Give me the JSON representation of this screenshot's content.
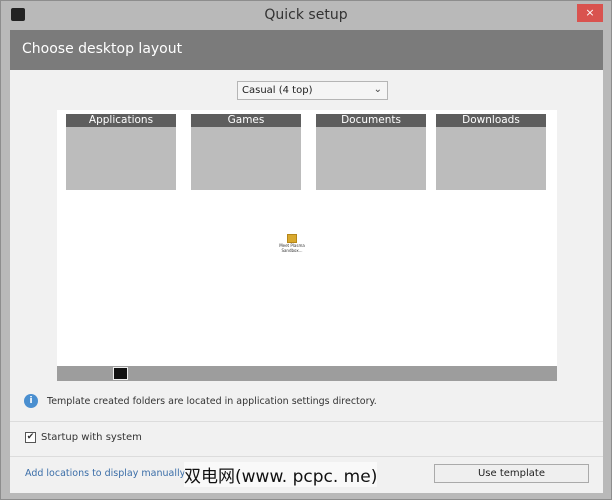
{
  "window": {
    "title": "Quick setup",
    "close": "×"
  },
  "header": {
    "title": "Choose desktop layout"
  },
  "layout_select": {
    "value": "Casual (4 top)",
    "chevron": "⌄"
  },
  "preview": {
    "folders": [
      "Applications",
      "Games",
      "Documents",
      "Downloads"
    ],
    "desktop_icon_label": "Meet Plasma Sandbox..."
  },
  "info": {
    "icon": "i",
    "text": "Template created folders are located in application settings directory."
  },
  "startup": {
    "checked": true,
    "check_glyph": "✔",
    "label": "Startup with system"
  },
  "footer": {
    "link": "Add locations to display manually",
    "button": "Use template"
  },
  "watermark": "双电网(www. pcpc. me)"
}
